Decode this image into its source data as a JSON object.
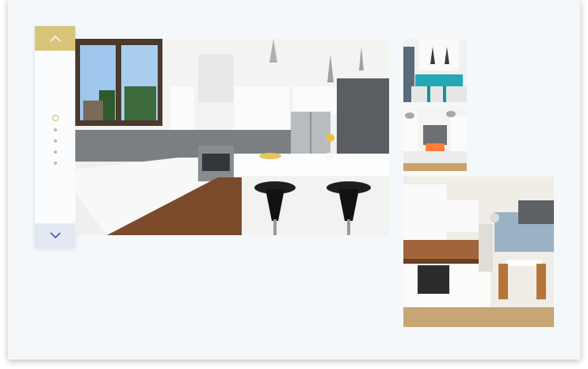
{
  "slider": {
    "up_icon": "chevron-up-icon",
    "down_icon": "chevron-down-icon",
    "page_count": 5,
    "active_index": 0,
    "accent_color": "#d8c57a"
  },
  "gallery": {
    "main_image": "white-kitchen-with-island-and-black-bar-stools",
    "thumbnails": [
      "white-kitchen-with-teal-accents",
      "white-kitchen-with-pendant-lights",
      "compact-kitchen-with-wooden-counter-and-dining-nook"
    ]
  }
}
